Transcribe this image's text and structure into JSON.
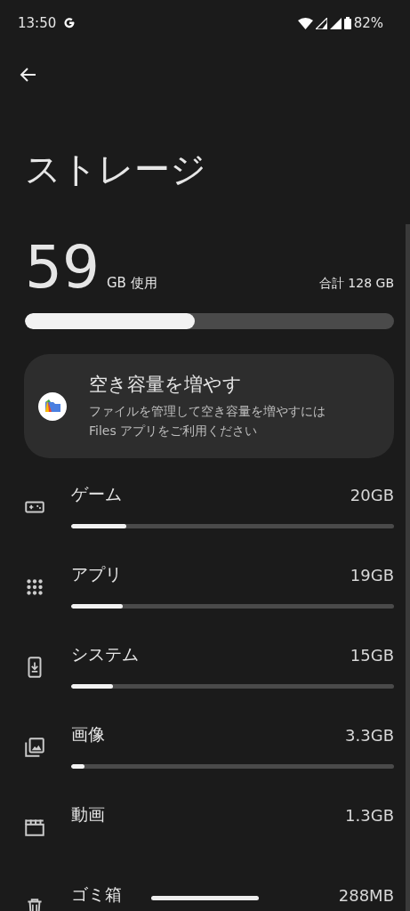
{
  "status_bar": {
    "time": "13:50",
    "battery": "82%"
  },
  "title": "ストレージ",
  "usage": {
    "used": "59",
    "used_unit": "GB 使用",
    "total": "合計 128 GB",
    "level": 0.46
  },
  "card": {
    "title": "空き容量を増やす",
    "description": "ファイルを管理して空き容量を増やすには Files アプリをご利用ください"
  },
  "categories": [
    {
      "kind": "game",
      "label": "ゲーム",
      "size": "20GB",
      "level": 0.17
    },
    {
      "kind": "apps",
      "label": "アプリ",
      "size": "19GB",
      "level": 0.16
    },
    {
      "kind": "system",
      "label": "システム",
      "size": "15GB",
      "level": 0.13
    },
    {
      "kind": "images",
      "label": "画像",
      "size": "3.3GB",
      "level": 0.04
    },
    {
      "kind": "video",
      "label": "動画",
      "size": "1.3GB"
    },
    {
      "kind": "trash",
      "label": "ゴミ箱",
      "size": "288MB"
    }
  ]
}
